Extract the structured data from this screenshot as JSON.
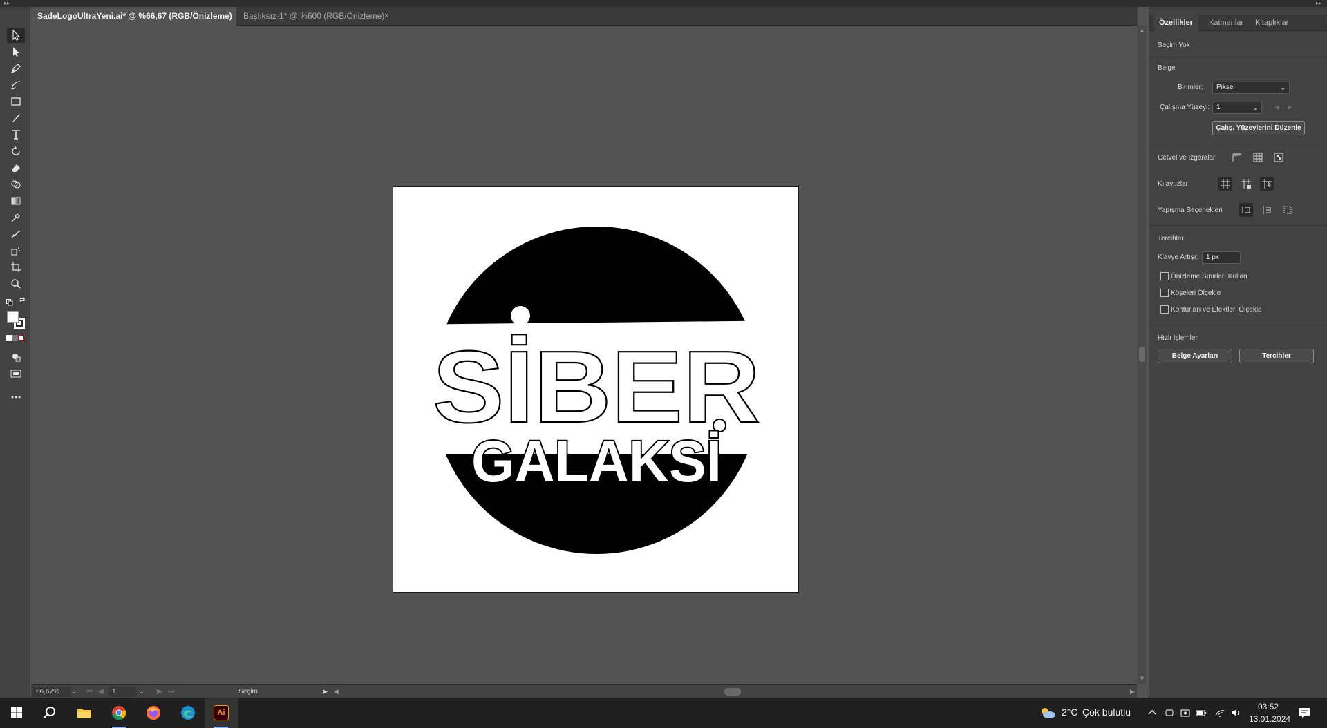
{
  "document_tabs": [
    {
      "label": "SadeLogoUltraYeni.ai* @ %66,67 (RGB/Önizleme)",
      "close": "×"
    },
    {
      "label": "Başlıksız-1* @ %600 (RGB/Önizleme)",
      "close": "×"
    }
  ],
  "artwork": {
    "word1": "SİBER",
    "word2": "GALAKSİ"
  },
  "statusbar": {
    "zoom": "66,67%",
    "artboard": "1",
    "mode": "Seçim"
  },
  "panel": {
    "tabs": [
      "Özellikler",
      "Katmanlar",
      "Kitaplıklar"
    ],
    "selection": "Seçim Yok",
    "document_section": "Belge",
    "units_label": "Birimler:",
    "units_value": "Piksel",
    "artboard_label": "Çalışma Yüzeyi:",
    "artboard_value": "1",
    "edit_artboards": "Çalış. Yüzeylerini Düzenle",
    "rulers_label": "Cetvel ve Izgaralar",
    "guides_label": "Kılavuzlar",
    "snap_label": "Yapışma Seçenekleri",
    "prefs_section": "Tercihler",
    "keyboard_label": "Klavye Artışı:",
    "keyboard_value": "1 px",
    "checkboxes": [
      "Önizleme Sınırları Kullan",
      "Köşeleri Ölçekle",
      "Konturları ve Efektleri Ölçekle"
    ],
    "quick_section": "Hızlı İşlemler",
    "doc_settings": "Belge Ayarları",
    "preferences": "Tercihler"
  },
  "taskbar": {
    "temperature": "2°C",
    "weather": "Çok bulutlu",
    "time": "03:52",
    "date": "13.01.2024",
    "illustrator_label": "Ai"
  }
}
